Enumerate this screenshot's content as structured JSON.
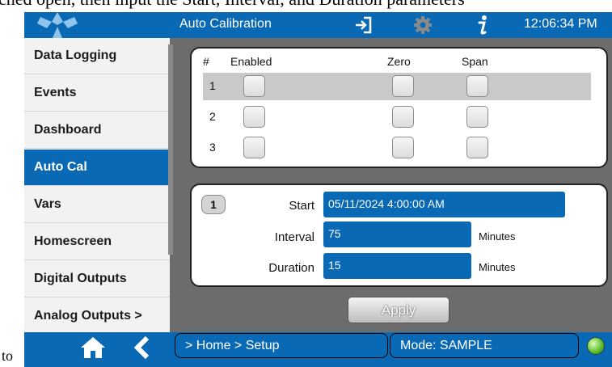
{
  "document": {
    "caption_top": "ched open, then input the Start, Interval, and Duration parameters",
    "caption_bottom": "to"
  },
  "header": {
    "title": "Auto Calibration",
    "time": "12:06:34 PM",
    "icons": [
      "logo",
      "exit-icon",
      "gear-icon",
      "info-icon"
    ]
  },
  "sidebar": {
    "items": [
      {
        "label": "Data Logging",
        "active": false
      },
      {
        "label": "Events",
        "active": false
      },
      {
        "label": "Dashboard",
        "active": false
      },
      {
        "label": "Auto Cal",
        "active": true
      },
      {
        "label": "Vars",
        "active": false
      },
      {
        "label": "Homescreen",
        "active": false
      },
      {
        "label": "Digital Outputs",
        "active": false
      },
      {
        "label": "Analog Outputs >",
        "active": false
      }
    ]
  },
  "schedule_table": {
    "headers": {
      "num": "#",
      "enabled": "Enabled",
      "zero": "Zero",
      "span": "Span"
    },
    "rows": [
      {
        "num": "1",
        "enabled": false,
        "zero": false,
        "span": false,
        "selected": true
      },
      {
        "num": "2",
        "enabled": false,
        "zero": false,
        "span": false,
        "selected": false
      },
      {
        "num": "3",
        "enabled": false,
        "zero": false,
        "span": false,
        "selected": false
      }
    ]
  },
  "parameters": {
    "sequence_badge": "1",
    "start_label": "Start",
    "start_value": "05/11/2024 4:00:00 AM",
    "interval_label": "Interval",
    "interval_value": "75",
    "interval_unit": "Minutes",
    "duration_label": "Duration",
    "duration_value": "15",
    "duration_unit": "Minutes"
  },
  "apply_label": "Apply",
  "footer": {
    "breadcrumb": "> Home > Setup",
    "mode": "Mode: SAMPLE",
    "icons": [
      "home-icon",
      "back-icon",
      "status-led-icon"
    ],
    "colors": {
      "bar": "#0a69b4",
      "led": "#5cb82a"
    }
  }
}
